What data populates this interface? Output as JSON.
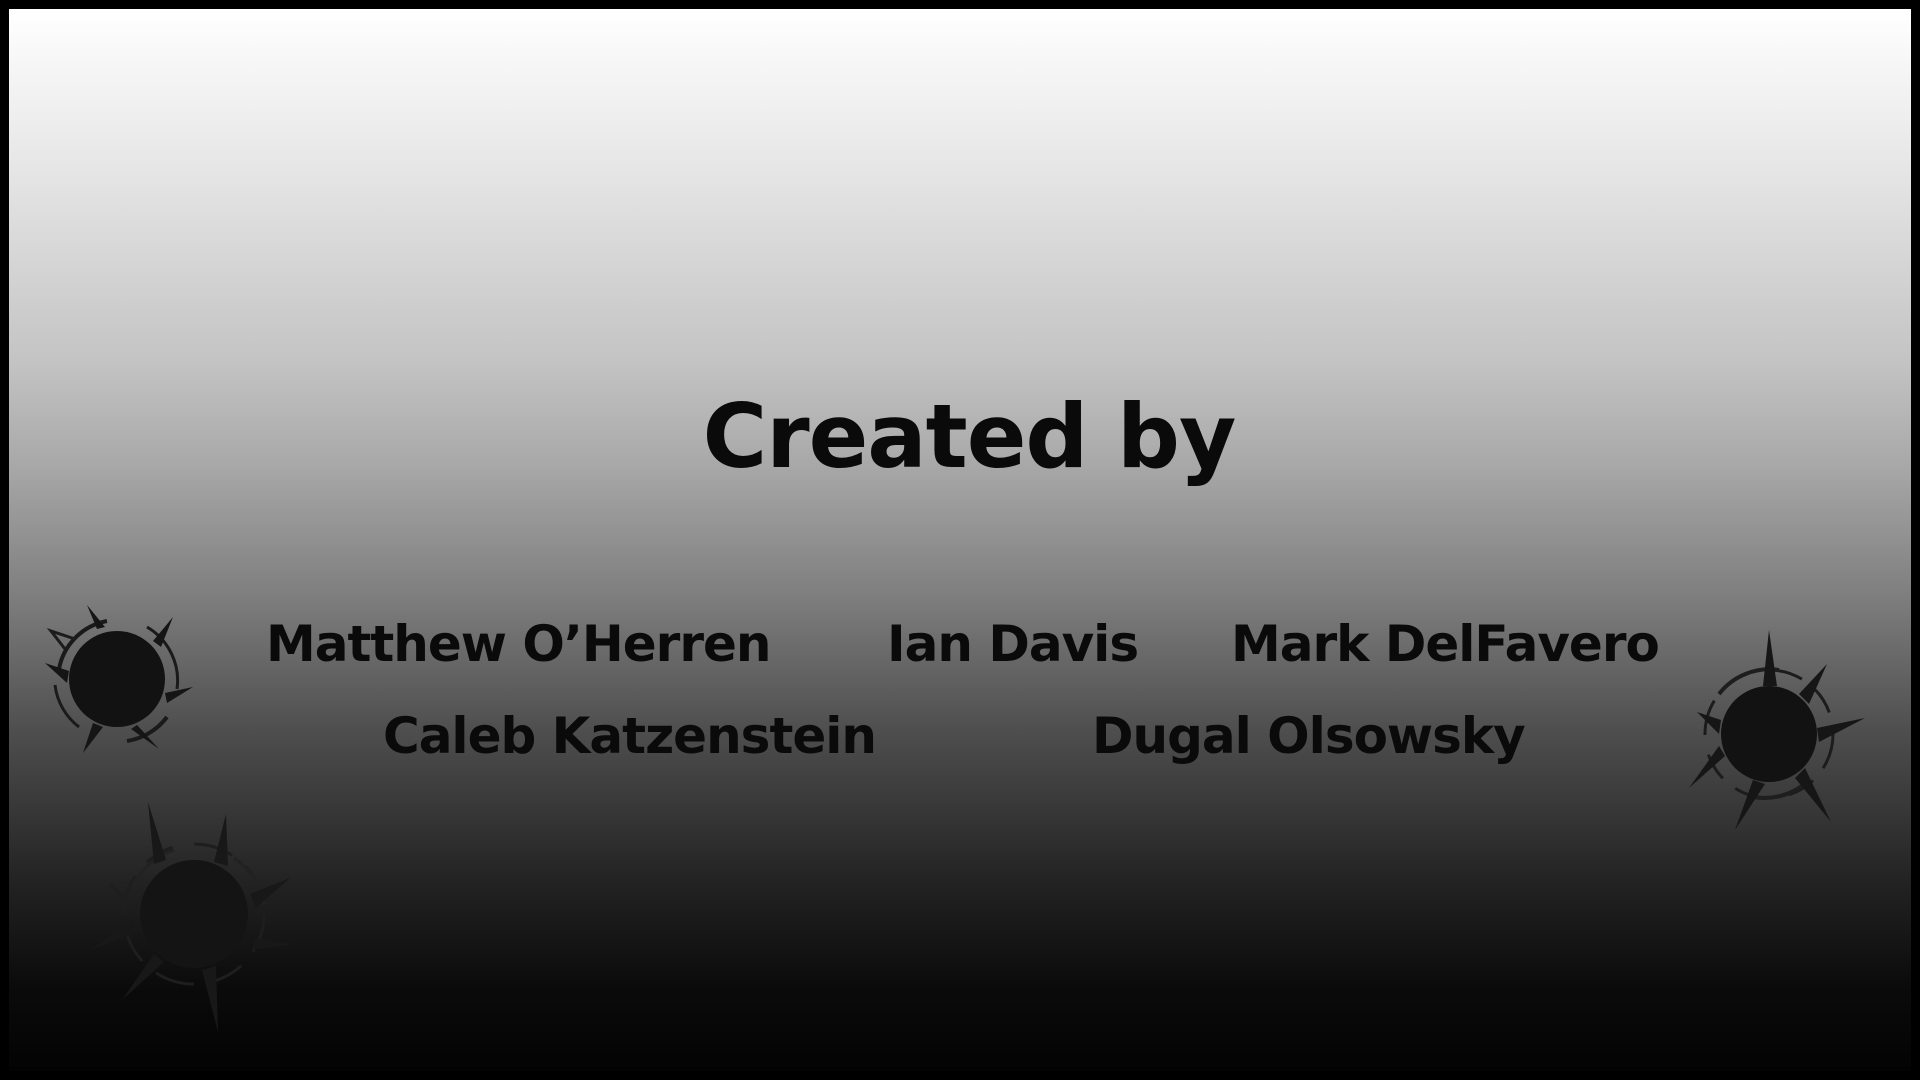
{
  "credits": {
    "title": "Created by",
    "names": [
      "Matthew O’Herren",
      "Ian Davis",
      "Mark DelFavero",
      "Caleb Katzenstein",
      "Dugal Olsowsky"
    ]
  },
  "decorations": {
    "icon": "bullet-hole-icon",
    "count": 3
  },
  "colors": {
    "text": "#0a0a0a",
    "gradient_top": "#ffffff",
    "gradient_bottom": "#030303",
    "frame": "#000000"
  }
}
